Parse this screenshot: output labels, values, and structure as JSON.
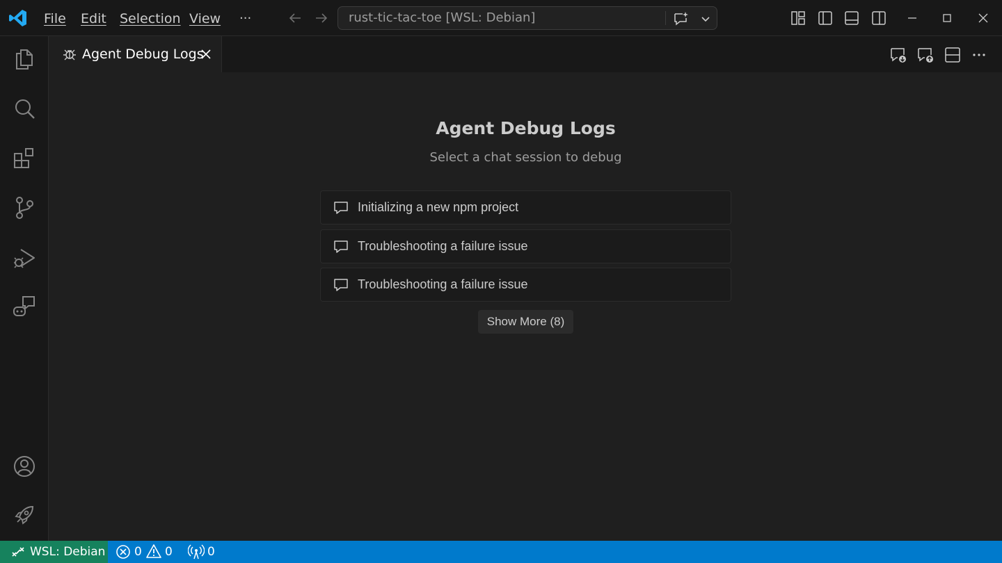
{
  "titlebar": {
    "menus": [
      "File",
      "Edit",
      "Selection",
      "View"
    ],
    "more_label": "···",
    "search_text": "rust-tic-tac-toe [WSL: Debian]"
  },
  "tab": {
    "title": "Agent Debug Logs"
  },
  "content": {
    "heading": "Agent Debug Logs",
    "subheading": "Select a chat session to debug",
    "sessions": [
      "Initializing a new npm project",
      "Troubleshooting a failure issue",
      "Troubleshooting a failure issue"
    ],
    "show_more": "Show More (8)"
  },
  "statusbar": {
    "remote": "WSL: Debian",
    "errors": "0",
    "warnings": "0",
    "ports": "0"
  },
  "colors": {
    "accent": "#007acc",
    "remote": "#16825d",
    "logo": "#23a9f2"
  }
}
